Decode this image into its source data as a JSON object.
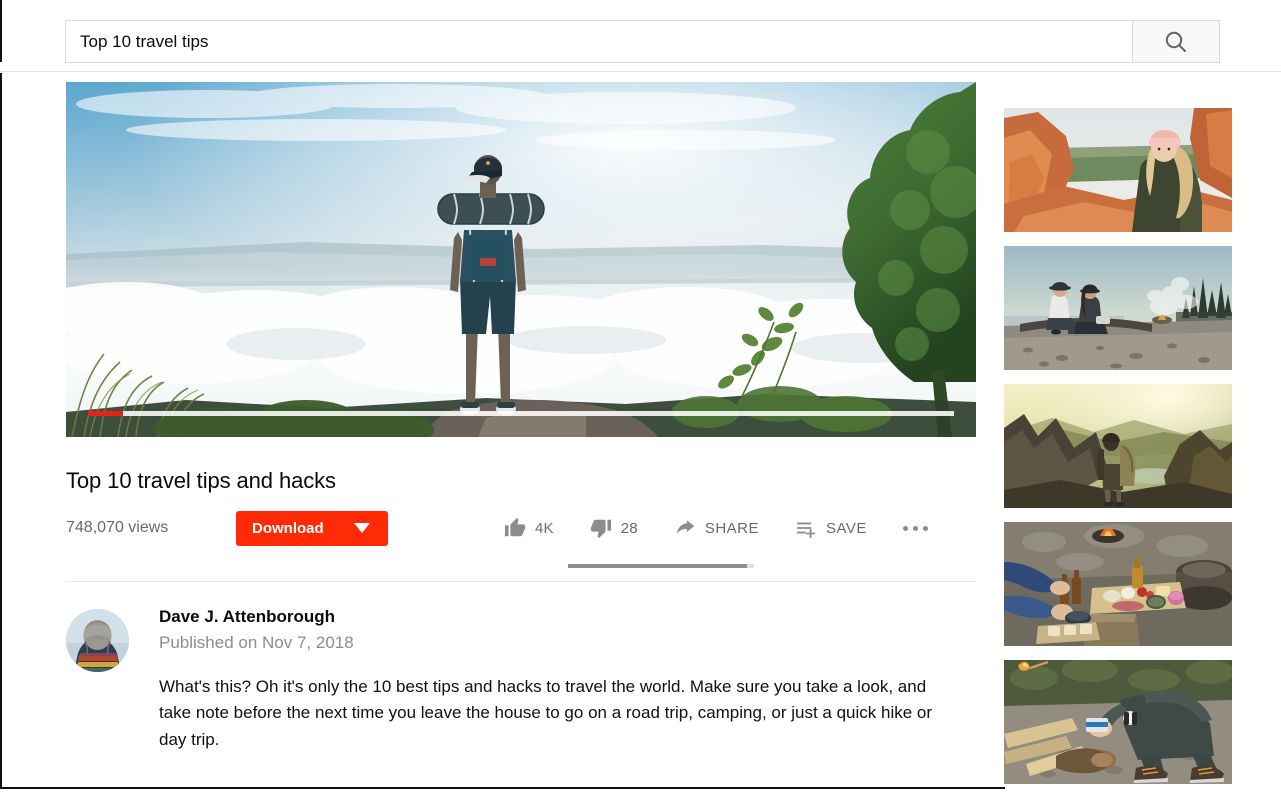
{
  "search": {
    "value": "Top 10 travel tips",
    "placeholder": "Search",
    "button_icon": "search-icon"
  },
  "player": {
    "progress_percent": 4,
    "image_alt": "Hiker with bedroll standing on a cliff above a sea of clouds",
    "played_color": "#e62117",
    "track_color": "#ffffff"
  },
  "video": {
    "title": "Top 10 travel tips and hacks",
    "views": "748,070 views",
    "download_label": "Download",
    "download_color": "#ff2b06",
    "likes": "4K",
    "dislikes": "28",
    "share_label": "SHARE",
    "save_label": "SAVE",
    "more_label": "more-options",
    "like_ratio_percent": 96
  },
  "channel": {
    "name": "Dave J. Attenborough",
    "published": "Published on Nov 7, 2018",
    "avatar_alt": "Person in a gray knit beanie and striped poncho seen from behind",
    "description": "What's this? Oh it's only the 10 best tips and hacks to travel the world. Make sure you take a look, and take note before the next time you leave the house to go on a road trip, camping, or just a quick hike or day trip."
  },
  "sidebar": {
    "thumbnails": [
      {
        "alt": "Woman in pink beanie looking back over red rock canyon"
      },
      {
        "alt": "Two people sitting on driftwood by a smoky beach campfire at dusk"
      },
      {
        "alt": "Backpacker standing on a ridge overlooking a sunlit mountain valley"
      },
      {
        "alt": "Charcuterie board and bottles spread on a log beside a campfire"
      },
      {
        "alt": "Person crouching on gravel holding a matchbox next to kindling"
      }
    ]
  }
}
